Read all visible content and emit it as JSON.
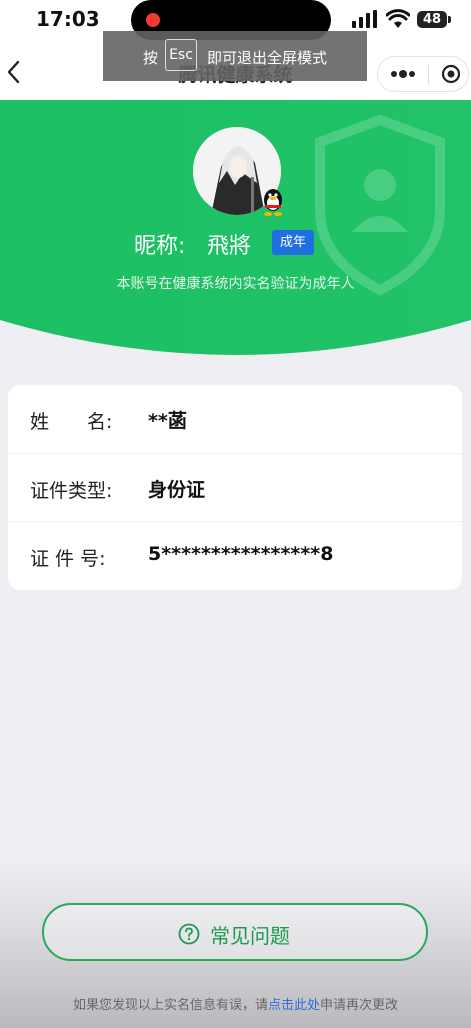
{
  "status_bar": {
    "time": "17:03",
    "battery": "48"
  },
  "nav": {
    "title": "腾讯健康系统"
  },
  "esc_hint": {
    "prefix": "按",
    "key": "Esc",
    "suffix": "即可退出全屏模式"
  },
  "profile": {
    "nickname_label": "昵称:",
    "nickname": "飛將",
    "badge": "成年",
    "verify_text": "本账号在健康系统内实名验证为成年人"
  },
  "info": {
    "rows": [
      {
        "label": "姓　　名:",
        "value": "**菡"
      },
      {
        "label": "证件类型:",
        "value": "身份证"
      },
      {
        "label": "证 件 号:",
        "value": "5****************8"
      }
    ]
  },
  "faq": {
    "label": "常见问题"
  },
  "footer": {
    "text_before": "如果您发现以上实名信息有误，请",
    "link": "点击此处",
    "text_after": "申请再次更改"
  },
  "colors": {
    "green": "#1fbe63",
    "badge_blue": "#1f6fe0",
    "faq_green": "#1d9a52"
  }
}
